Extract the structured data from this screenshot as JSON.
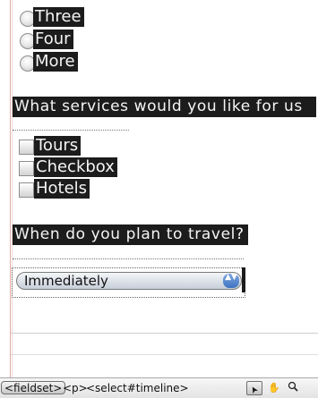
{
  "form": {
    "radio_options": [
      "Three",
      "Four",
      "More"
    ],
    "services_question": "What services would you like for us",
    "checkbox_options": [
      "Tours",
      "Checkbox",
      "Hotels"
    ],
    "travel_question": "When do you plan to travel?",
    "timeline_select": {
      "selected": "Immediately",
      "arrows": "▲▼"
    }
  },
  "status_bar": {
    "tags": [
      "<fieldset>",
      "<p>",
      "<select#timeline>"
    ],
    "tools": {
      "pointer": {
        "icon": "pointer-icon",
        "glyph": "➤"
      },
      "hand": {
        "icon": "hand-icon",
        "glyph": "✋"
      },
      "zoom": {
        "icon": "zoom-icon",
        "glyph": "🔍"
      }
    }
  }
}
